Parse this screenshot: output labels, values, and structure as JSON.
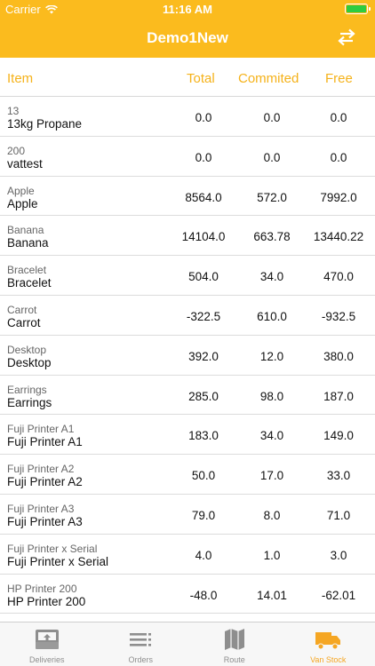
{
  "status": {
    "carrier": "Carrier",
    "time": "11:16 AM"
  },
  "nav": {
    "title": "Demo1New",
    "swap_icon": "swap-arrows-icon"
  },
  "columns": {
    "item": "Item",
    "total": "Total",
    "committed": "Commited",
    "free": "Free"
  },
  "rows": [
    {
      "code": "13",
      "name": "13kg Propane",
      "total": "0.0",
      "committed": "0.0",
      "free": "0.0"
    },
    {
      "code": "200",
      "name": "vattest",
      "total": "0.0",
      "committed": "0.0",
      "free": "0.0"
    },
    {
      "code": "Apple",
      "name": "Apple",
      "total": "8564.0",
      "committed": "572.0",
      "free": "7992.0"
    },
    {
      "code": "Banana",
      "name": "Banana",
      "total": "14104.0",
      "committed": "663.78",
      "free": "13440.22"
    },
    {
      "code": "Bracelet",
      "name": "Bracelet",
      "total": "504.0",
      "committed": "34.0",
      "free": "470.0"
    },
    {
      "code": "Carrot",
      "name": "Carrot",
      "total": "-322.5",
      "committed": "610.0",
      "free": "-932.5"
    },
    {
      "code": "Desktop",
      "name": "Desktop",
      "total": "392.0",
      "committed": "12.0",
      "free": "380.0"
    },
    {
      "code": "Earrings",
      "name": "Earrings",
      "total": "285.0",
      "committed": "98.0",
      "free": "187.0"
    },
    {
      "code": "Fuji Printer A1",
      "name": "Fuji Printer A1",
      "total": "183.0",
      "committed": "34.0",
      "free": "149.0"
    },
    {
      "code": "Fuji Printer A2",
      "name": "Fuji Printer A2",
      "total": "50.0",
      "committed": "17.0",
      "free": "33.0"
    },
    {
      "code": "Fuji Printer A3",
      "name": "Fuji Printer A3",
      "total": "79.0",
      "committed": "8.0",
      "free": "71.0"
    },
    {
      "code": "Fuji Printer x Serial",
      "name": "Fuji Printer x Serial",
      "total": "4.0",
      "committed": "1.0",
      "free": "3.0"
    },
    {
      "code": "HP Printer 200",
      "name": "HP Printer 200",
      "total": "-48.0",
      "committed": "14.01",
      "free": "-62.01"
    }
  ],
  "tabs": [
    {
      "label": "Deliveries",
      "icon": "deliveries-tray-icon",
      "active": false
    },
    {
      "label": "Orders",
      "icon": "orders-list-icon",
      "active": false
    },
    {
      "label": "Route",
      "icon": "route-map-icon",
      "active": false
    },
    {
      "label": "Van Stock",
      "icon": "van-truck-icon",
      "active": true
    }
  ],
  "colors": {
    "accent": "#fbbb1e",
    "header_text": "#f5b21a",
    "active_tab": "#f5a623"
  }
}
